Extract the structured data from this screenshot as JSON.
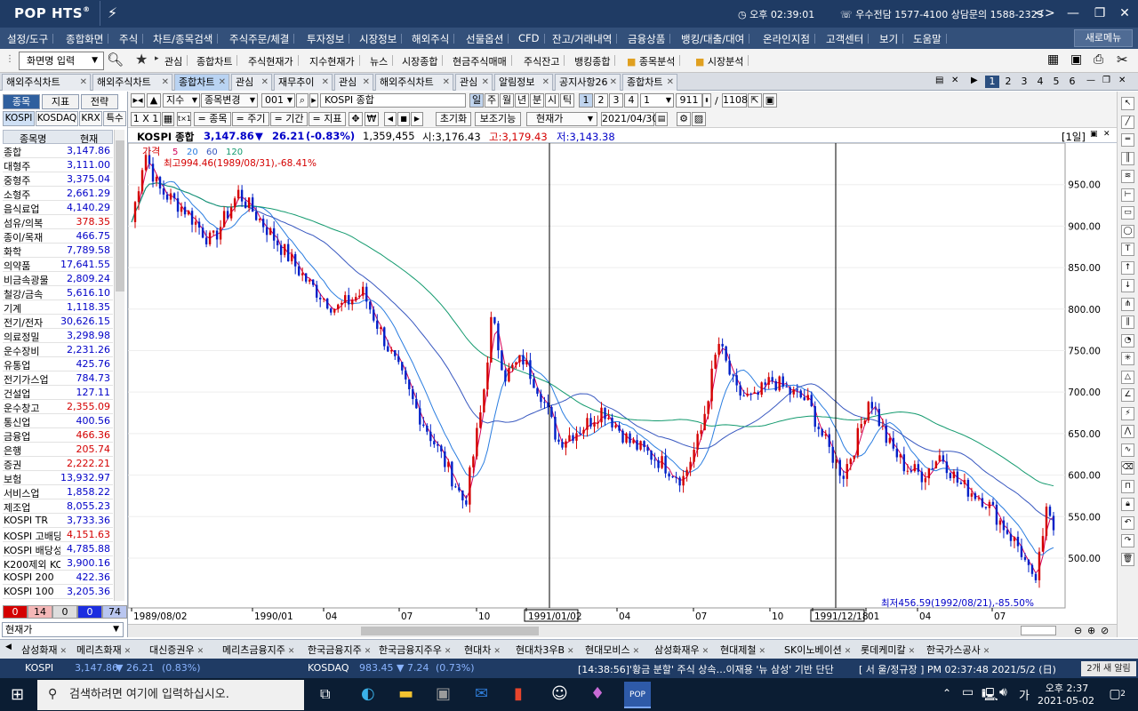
{
  "app": {
    "logo": "POP HTS",
    "logo_sup": "®",
    "clock": "오후 02:39:01",
    "phone": "우수전담 1577-4100 상담문의 1588-2323"
  },
  "menu": [
    "설정/도구",
    "종합화면",
    "주식",
    "차트/종목검색",
    "주식주문/체결",
    "투자정보",
    "시장정보",
    "해외주식",
    "선물옵션",
    "CFD",
    "잔고/거래내역",
    "금융상품",
    "뱅킹/대출/대여",
    "온라인지점",
    "고객센터",
    "보기",
    "도움말"
  ],
  "new_window": "새로메뉴",
  "toolbar": {
    "screen_input": "화면명 입력",
    "items": [
      "관심",
      "종합차트",
      "주식현재가",
      "지수현재가",
      "뉴스",
      "시장종합",
      "현금주식매매",
      "주식잔고",
      "뱅킹종합",
      "종목분석",
      "시장분석"
    ]
  },
  "tabs": [
    "해외주식차트",
    "해외주식차트",
    "종합차트",
    "관심",
    "재무추이",
    "관심",
    "해외주식차트",
    "관심",
    "알림정보",
    "공지사항26",
    "종합차트"
  ],
  "page_nums": [
    "1",
    "2",
    "3",
    "4",
    "5",
    "6"
  ],
  "left": {
    "tabs": [
      "종목",
      "지표",
      "전략"
    ],
    "markets": [
      "KOSPI",
      "KOSDAQ",
      "KRX",
      "특수"
    ],
    "col_name": "종목명",
    "col_price": "현재",
    "rows": [
      {
        "n": "종합",
        "v": "3,147.86",
        "c": "dn"
      },
      {
        "n": "대형주",
        "v": "3,111.00",
        "c": "dn"
      },
      {
        "n": "중형주",
        "v": "3,375.04",
        "c": "dn"
      },
      {
        "n": "소형주",
        "v": "2,661.29",
        "c": "dn"
      },
      {
        "n": "음식료업",
        "v": "4,140.29",
        "c": "dn"
      },
      {
        "n": "섬유/의복",
        "v": "378.35",
        "c": "up"
      },
      {
        "n": "종이/목재",
        "v": "466.75",
        "c": "dn"
      },
      {
        "n": "화학",
        "v": "7,789.58",
        "c": "dn"
      },
      {
        "n": "의약품",
        "v": "17,641.55",
        "c": "dn"
      },
      {
        "n": "비금속광물",
        "v": "2,809.24",
        "c": "dn"
      },
      {
        "n": "철강/금속",
        "v": "5,616.10",
        "c": "dn"
      },
      {
        "n": "기계",
        "v": "1,118.35",
        "c": "dn"
      },
      {
        "n": "전기/전자",
        "v": "30,626.15",
        "c": "dn"
      },
      {
        "n": "의료정밀",
        "v": "3,298.98",
        "c": "dn"
      },
      {
        "n": "운수장비",
        "v": "2,231.26",
        "c": "dn"
      },
      {
        "n": "유통업",
        "v": "425.76",
        "c": "dn"
      },
      {
        "n": "전기가스업",
        "v": "784.73",
        "c": "dn"
      },
      {
        "n": "건설업",
        "v": "127.11",
        "c": "dn"
      },
      {
        "n": "운수창고",
        "v": "2,355.09",
        "c": "up"
      },
      {
        "n": "통신업",
        "v": "400.56",
        "c": "dn"
      },
      {
        "n": "금융업",
        "v": "466.36",
        "c": "up"
      },
      {
        "n": "은행",
        "v": "205.74",
        "c": "up"
      },
      {
        "n": "증권",
        "v": "2,222.21",
        "c": "up"
      },
      {
        "n": "보험",
        "v": "13,932.97",
        "c": "dn"
      },
      {
        "n": "서비스업",
        "v": "1,858.22",
        "c": "dn"
      },
      {
        "n": "제조업",
        "v": "8,055.23",
        "c": "dn"
      },
      {
        "n": "KOSPI TR",
        "v": "3,733.36",
        "c": "dn"
      },
      {
        "n": "KOSPI 고배당",
        "v": "4,151.63",
        "c": "up"
      },
      {
        "n": "KOSPI 배당성",
        "v": "4,785.88",
        "c": "dn"
      },
      {
        "n": "K200제외 KO",
        "v": "3,900.16",
        "c": "dn"
      },
      {
        "n": "KOSPI 200",
        "v": "422.36",
        "c": "dn"
      },
      {
        "n": "KOSPI 100",
        "v": "3,205.36",
        "c": "dn"
      }
    ],
    "counts": [
      "0",
      "14",
      "0",
      "0",
      "74"
    ],
    "price_select": "현재가"
  },
  "controls": {
    "index_type": "지수",
    "change_code": "종목변경",
    "code": "001",
    "name": "KOSPI 종합",
    "periods": [
      "일",
      "주",
      "월",
      "년",
      "분",
      "시",
      "틱"
    ],
    "nums": [
      "1",
      "2",
      "3",
      "4"
    ],
    "sel_num": "1",
    "count_a": "911",
    "count_b": "1108",
    "row2": [
      "1 X 1",
      "= 종목",
      "= 주기",
      "= 기간",
      "= 지표"
    ],
    "reset": "초기화",
    "assist": "보조기능",
    "price_type": "현재가",
    "date": "2021/04/30"
  },
  "info": {
    "name": "KOSPI 종합",
    "price": "3,147.86",
    "arrow": "▼",
    "change": "26.21",
    "pct": "(-0.83%)",
    "volume": "1,359,455",
    "open": "시:3,176.43",
    "high": "고:3,179.43",
    "low": "저:3,143.38",
    "period_tag": "[1일]"
  },
  "stock_tabs": [
    "삼성화재",
    "메리츠화재",
    "대신증권우",
    "메리츠금융지주",
    "한국금융지주",
    "한국금융지주우",
    "현대차",
    "현대차3우B",
    "현대모비스",
    "삼성화재우",
    "현대제철",
    "SK이노베이션",
    "롯데케미칼",
    "한국가스공사"
  ],
  "ticker": {
    "kospi_label": "KOSPI",
    "kospi_val": "3,147.86",
    "kospi_chg": "▼ 26.21",
    "kospi_pct": "(0.83%)",
    "kosdaq_label": "KOSDAQ",
    "kosdaq_val": "983.45",
    "kosdaq_chg": "▼ 7.24",
    "kosdaq_pct": "(0.73%)",
    "news": "[14:38:56]'황금 분할' 주식 상속…이재용 '뉴 삼성' 기반 단단",
    "status": "[ 서  울/정규장 ] PM 02:37:48  2021/5/2 (日)",
    "alert": "2개 새 알림"
  },
  "taskbar": {
    "search": "검색하려면 여기에 입력하십시오.",
    "time": "오후 2:37",
    "date": "2021-05-02",
    "lang": "가",
    "notif": "2"
  },
  "chart_data": {
    "type": "candlestick",
    "legend": [
      "가격",
      "5",
      "20",
      "60",
      "120"
    ],
    "colors": {
      "up": "#d40000",
      "down": "#0020c8",
      "ma5": "#d4005a",
      "ma20": "#2a7de0",
      "ma60": "#3858c0",
      "ma120": "#139a6e"
    },
    "ylim": [
      440,
      1000
    ],
    "y_ticks": [
      "950.00",
      "900.00",
      "850.00",
      "800.00",
      "750.00",
      "700.00",
      "650.00",
      "600.00",
      "550.00",
      "500.00"
    ],
    "x_ticks": [
      "1989/08/02",
      "1990/01",
      "04",
      "07",
      "10",
      "1991/01/02",
      "04",
      "07",
      "10",
      "1991/12/18",
      "01",
      "04",
      "07"
    ],
    "high_note": "최고994.46(1989/08/31),-68.41%",
    "low_note": "최저456.59(1992/08/21),-85.50%",
    "anchors": [
      [
        0,
        905
      ],
      [
        15,
        990
      ],
      [
        30,
        945
      ],
      [
        60,
        920
      ],
      [
        90,
        880
      ],
      [
        120,
        940
      ],
      [
        150,
        900
      ],
      [
        200,
        830
      ],
      [
        230,
        800
      ],
      [
        260,
        820
      ],
      [
        290,
        750
      ],
      [
        320,
        680
      ],
      [
        350,
        620
      ],
      [
        375,
        565
      ],
      [
        395,
        690
      ],
      [
        405,
        790
      ],
      [
        420,
        720
      ],
      [
        440,
        740
      ],
      [
        460,
        700
      ],
      [
        480,
        640
      ],
      [
        510,
        660
      ],
      [
        530,
        680
      ],
      [
        560,
        640
      ],
      [
        590,
        620
      ],
      [
        620,
        595
      ],
      [
        640,
        650
      ],
      [
        660,
        760
      ],
      [
        680,
        700
      ],
      [
        700,
        690
      ],
      [
        720,
        715
      ],
      [
        740,
        700
      ],
      [
        760,
        690
      ],
      [
        780,
        640
      ],
      [
        800,
        600
      ],
      [
        815,
        640
      ],
      [
        830,
        695
      ],
      [
        850,
        640
      ],
      [
        870,
        610
      ],
      [
        890,
        600
      ],
      [
        910,
        625
      ],
      [
        930,
        590
      ],
      [
        960,
        570
      ],
      [
        980,
        540
      ],
      [
        1000,
        510
      ],
      [
        1015,
        465
      ],
      [
        1025,
        520
      ],
      [
        1030,
        575
      ],
      [
        1037,
        540
      ]
    ]
  }
}
